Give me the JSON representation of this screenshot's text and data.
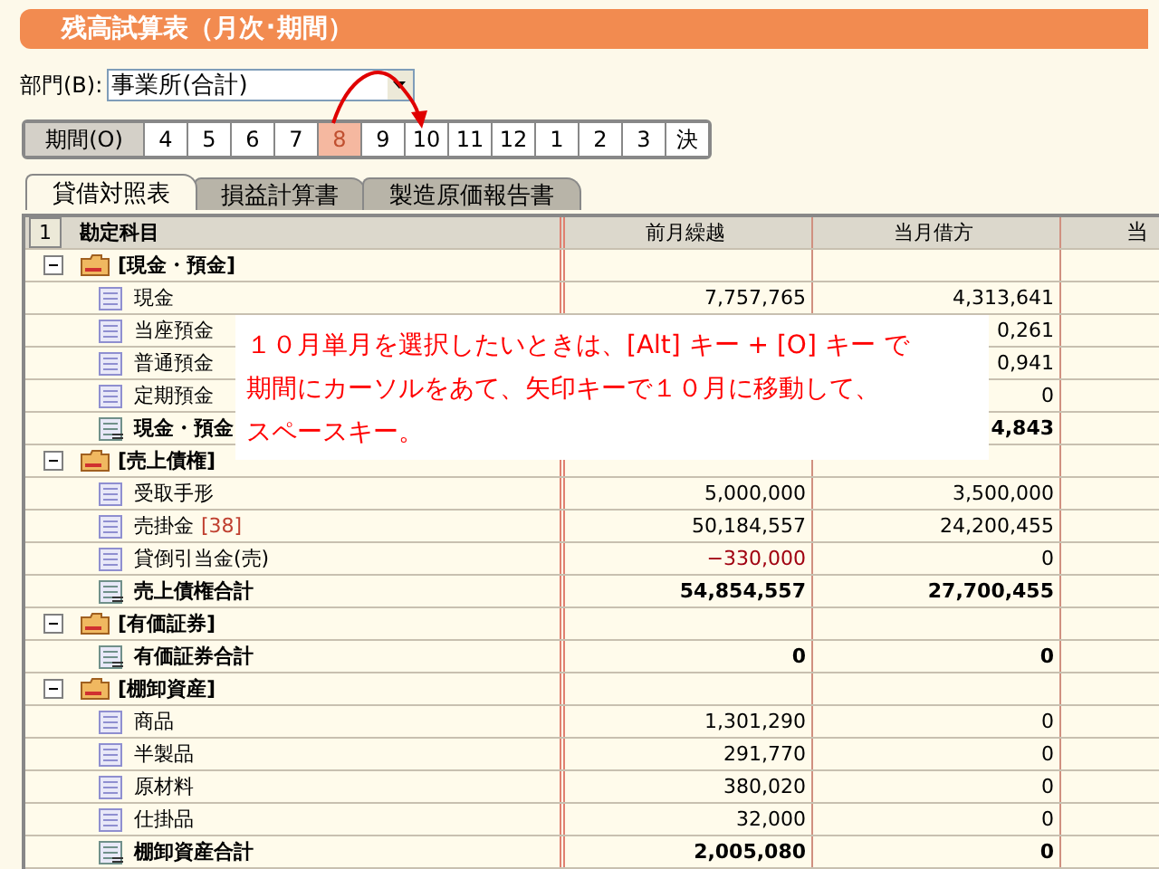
{
  "window": {
    "title": "残高試算表（月次･期間）"
  },
  "department": {
    "label": "部門(B):",
    "value": "事業所(合計)"
  },
  "period": {
    "label": "期間(O)",
    "months": [
      {
        "label": "4",
        "selected": false
      },
      {
        "label": "5",
        "selected": false
      },
      {
        "label": "6",
        "selected": false
      },
      {
        "label": "7",
        "selected": false
      },
      {
        "label": "8",
        "selected": true
      },
      {
        "label": "9",
        "selected": false
      },
      {
        "label": "10",
        "selected": false
      },
      {
        "label": "11",
        "selected": false
      },
      {
        "label": "12",
        "selected": false
      },
      {
        "label": "1",
        "selected": false
      },
      {
        "label": "2",
        "selected": false
      },
      {
        "label": "3",
        "selected": false
      },
      {
        "label": "決",
        "selected": false
      }
    ]
  },
  "tabs": [
    {
      "label": "貸借対照表",
      "selected": true
    },
    {
      "label": "損益計算書",
      "selected": false
    },
    {
      "label": "製造原価報告書",
      "selected": false
    }
  ],
  "table": {
    "corner": "1",
    "columns": [
      "勘定科目",
      "前月繰越",
      "当月借方",
      "当"
    ],
    "groups": [
      {
        "label": "[現金・預金]",
        "expanded": true,
        "children": [
          {
            "kind": "item",
            "label": "現金",
            "prev": "7,757,765",
            "debit": "4,313,641"
          },
          {
            "kind": "item",
            "label": "当座預金",
            "debit": "0,261"
          },
          {
            "kind": "item",
            "label": "普通預金",
            "debit": "0,941"
          },
          {
            "kind": "item",
            "label": "定期預金",
            "debit": "0"
          },
          {
            "kind": "total",
            "label": "現金・預金",
            "debit": "4,843"
          }
        ]
      },
      {
        "label": "[売上債権]",
        "expanded": true,
        "children": [
          {
            "kind": "item",
            "label": "受取手形",
            "prev": "5,000,000",
            "debit": "3,500,000"
          },
          {
            "kind": "item",
            "label": "売掛金",
            "badge": "[38]",
            "prev": "50,184,557",
            "debit": "24,200,455"
          },
          {
            "kind": "item",
            "label": "貸倒引当金(売)",
            "prev": "−330,000",
            "negative": true,
            "debit": "0"
          },
          {
            "kind": "total",
            "label": "売上債権合計",
            "prev": "54,854,557",
            "debit": "27,700,455"
          }
        ]
      },
      {
        "label": "[有価証券]",
        "expanded": true,
        "children": [
          {
            "kind": "total",
            "label": "有価証券合計",
            "prev": "0",
            "debit": "0"
          }
        ]
      },
      {
        "label": "[棚卸資産]",
        "expanded": true,
        "children": [
          {
            "kind": "item",
            "label": "商品",
            "prev": "1,301,290",
            "debit": "0"
          },
          {
            "kind": "item",
            "label": "半製品",
            "prev": "291,770",
            "debit": "0"
          },
          {
            "kind": "item",
            "label": "原材料",
            "prev": "380,020",
            "debit": "0"
          },
          {
            "kind": "item",
            "label": "仕掛品",
            "prev": "32,000",
            "debit": "0"
          },
          {
            "kind": "total",
            "label": "棚卸資産合計",
            "prev": "2,005,080",
            "debit": "0"
          }
        ]
      }
    ]
  },
  "callout": {
    "lines": [
      "１０月単月を選択したいときは、[Alt] キー + [O] キー で",
      "期間にカーソルをあて、矢印キーで１０月に移動して、",
      "スペースキー。"
    ]
  }
}
